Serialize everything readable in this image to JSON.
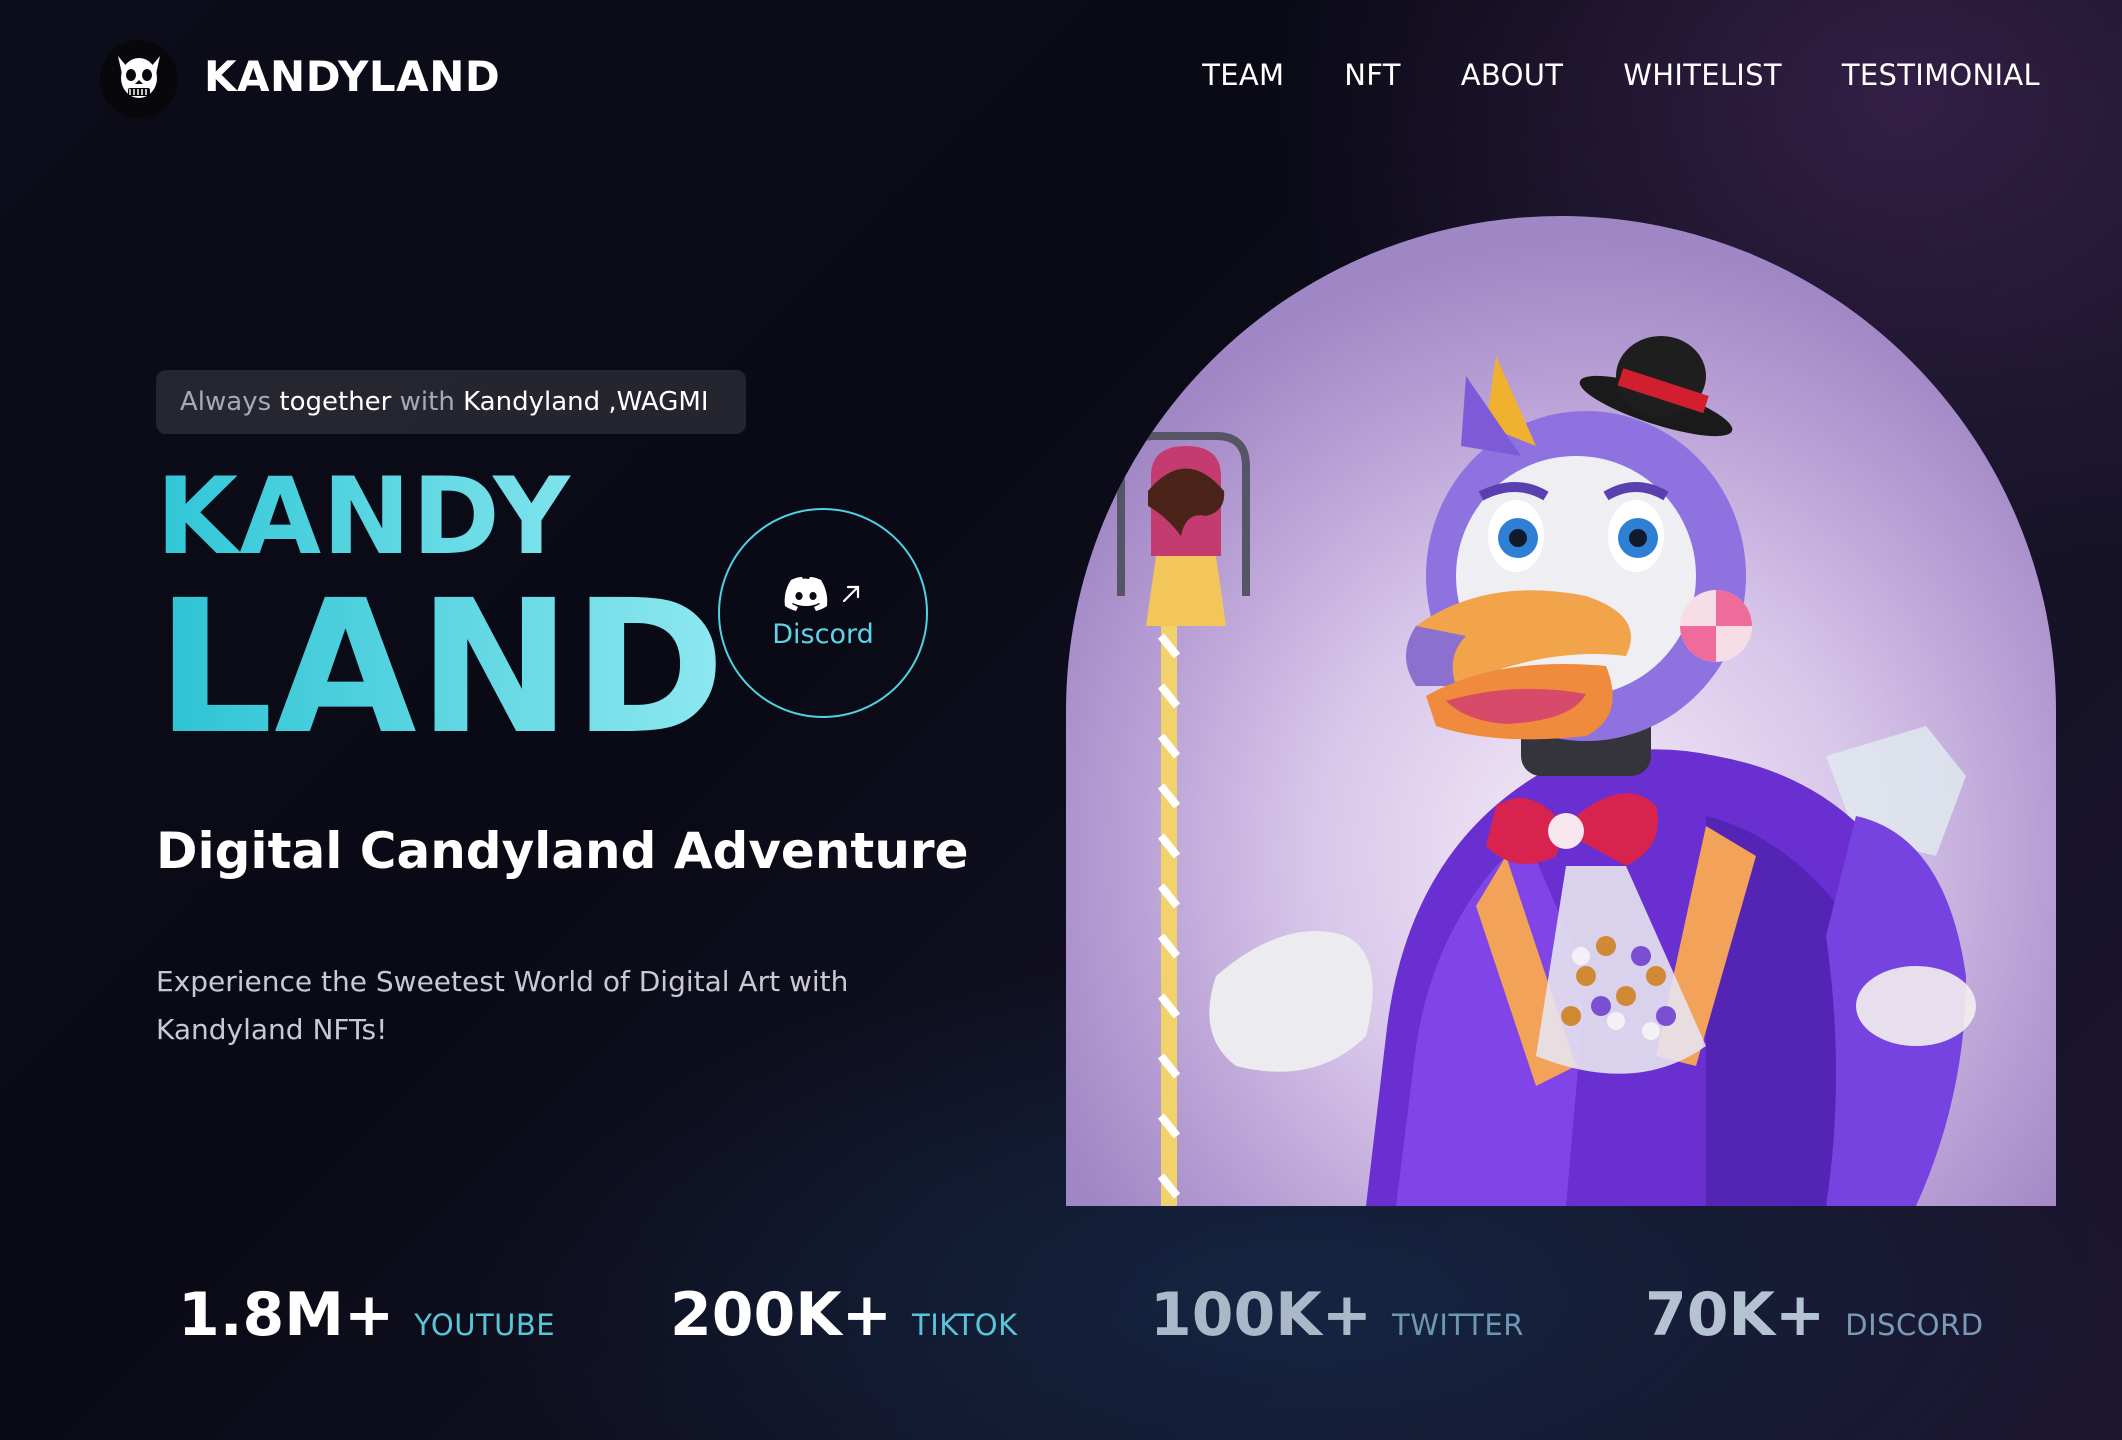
{
  "header": {
    "brand": "KANDYLAND",
    "logo_icon": "skull-mascot-icon",
    "nav": [
      "TEAM",
      "NFT",
      "ABOUT",
      "WHITELIST",
      "TESTIMONIAL"
    ]
  },
  "hero": {
    "tagline": {
      "p1": "Always",
      "p2": " together",
      "p3": " with",
      "p4": " Kandyland ,WAGMI"
    },
    "title_line1": "KANDY",
    "title_line2": "LAND",
    "discord_button": {
      "label": "Discord",
      "icon": "discord-icon",
      "arrow_icon": "arrow-up-right-icon"
    },
    "subtitle": "Digital Candyland Adventure",
    "description": "Experience the Sweetest World of Digital Art with Kandyland NFTs!",
    "image_alt": "animatronic-bird-mascot-illustration"
  },
  "stats": [
    {
      "value": "1.8M+",
      "label": "YOUTUBE",
      "value_color": "#ffffff",
      "label_color": "#58c6d8"
    },
    {
      "value": "200K+",
      "label": "TIKTOK",
      "value_color": "#ffffff",
      "label_color": "#58c6d8"
    },
    {
      "value": "100K+",
      "label": "TWITTER",
      "value_color": "#aab8c8",
      "label_color": "#6e97b3"
    },
    {
      "value": "70K+",
      "label": "DISCORD",
      "value_color": "#b4c2d2",
      "label_color": "#7a9bb8"
    }
  ],
  "colors": {
    "accent": "#2fc6d6",
    "background": "#0b0b17"
  }
}
